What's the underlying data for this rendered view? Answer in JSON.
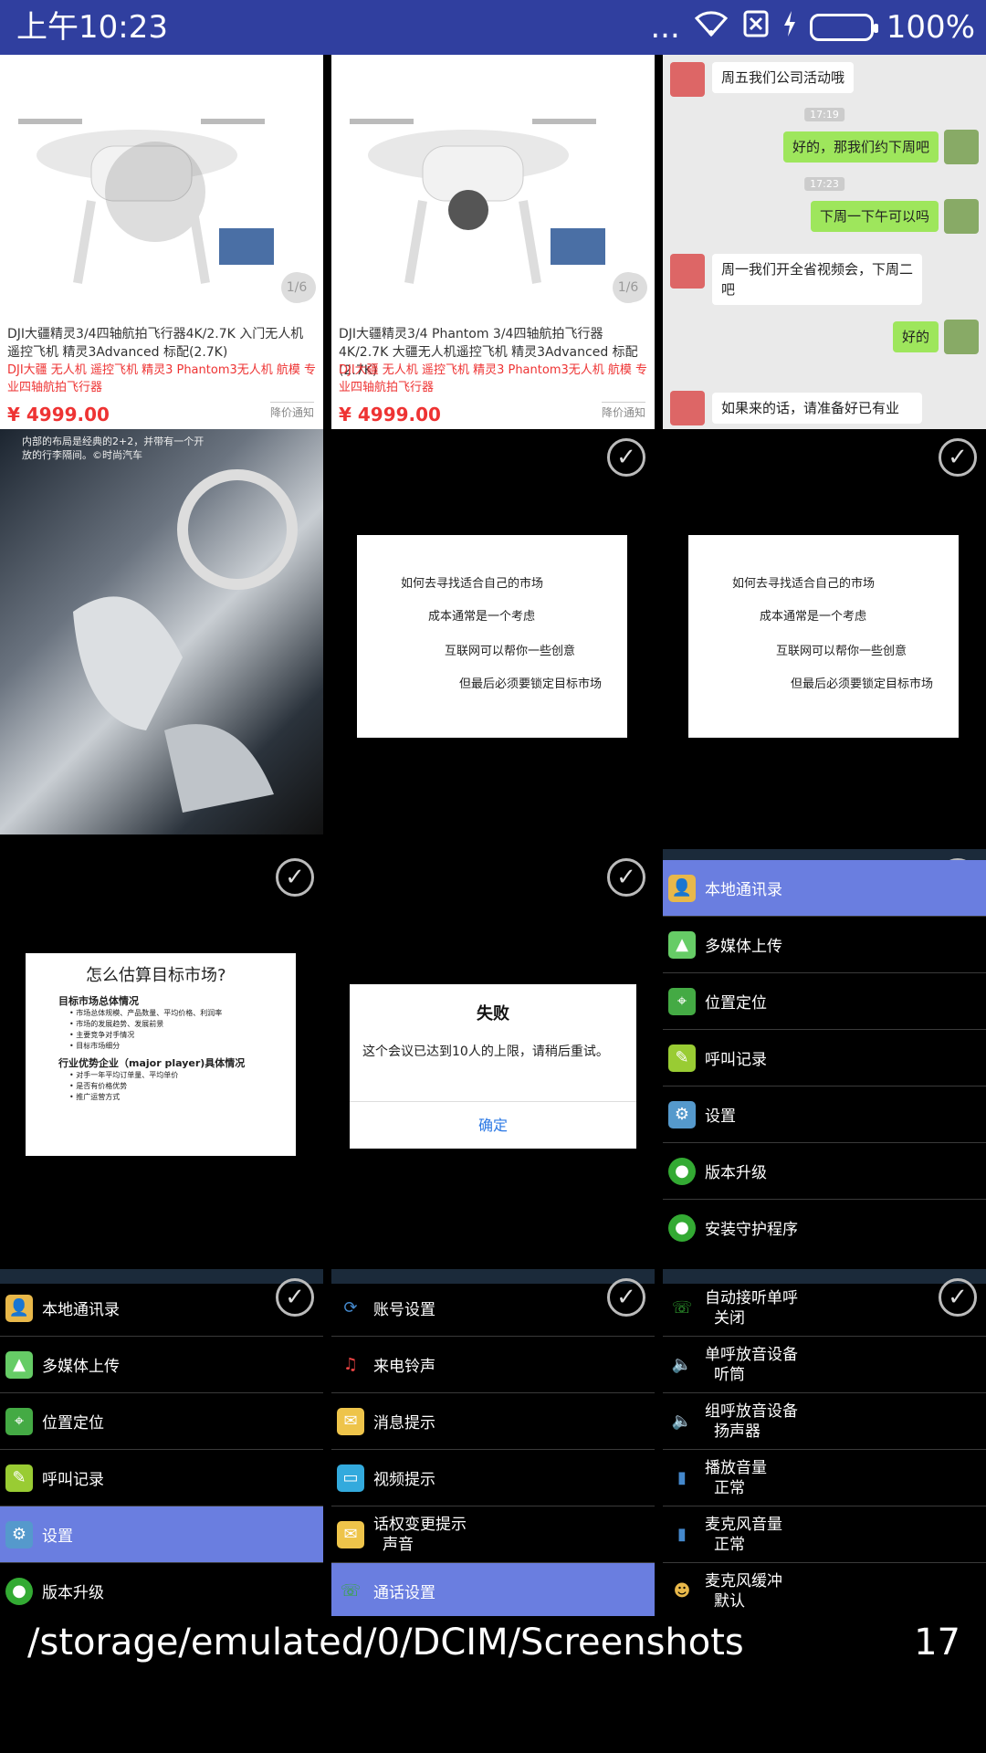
{
  "status_bar": {
    "time": "上午10:23",
    "dots": "...",
    "battery_percent": "100%"
  },
  "cells": {
    "p1": {
      "title": "DJI大疆精灵3/4四轴航拍飞行器4K/2.7K 入门无人机遥控飞机 精灵3Advanced 标配(2.7K)",
      "subtitle": "DJI大疆 无人机 遥控飞机 精灵3 Phantom3无人机 航模 专业四轴航拍飞行器",
      "price": "¥ 4999.00",
      "page": "1/6",
      "badge": "降价通知"
    },
    "p2": {
      "title": "DJI大疆精灵3/4 Phantom 3/4四轴航拍飞行器4K/2.7K 大疆无人机遥控飞机 精灵3Advanced 标配(2.7K)",
      "subtitle": "DJI大疆 无人机 遥控飞机 精灵3 Phantom3无人机 航模 专业四轴航拍飞行器",
      "price": "¥ 4999.00",
      "page": "1/6",
      "badge": "降价通知"
    },
    "chat": {
      "m1": "周五我们公司活动哦",
      "t1": "17:19",
      "m2": "好的，那我们约下周吧",
      "t2": "17:23",
      "m3": "下周一下午可以吗",
      "m4": "周一我们开全省视频会，下周二吧",
      "m5": "好的",
      "m6": "如果来的话，请准备好已有业"
    },
    "car": {
      "caption": "内部的布局是经典的2+2，并带有一个开放的行李隔间。©时尚汽车"
    },
    "slide1": {
      "l1": "如何去寻找适合自己的市场",
      "l2": "成本通常是一个考虑",
      "l3": "互联网可以帮你一些创意",
      "l4": "但最后必须要锁定目标市场"
    },
    "slide2": {
      "l1": "如何去寻找适合自己的市场",
      "l2": "成本通常是一个考虑",
      "l3": "互联网可以帮你一些创意",
      "l4": "但最后必须要锁定目标市场"
    },
    "slide3": {
      "title": "怎么估算目标市场?",
      "h1": "目标市场总体情况",
      "b1": "• 市场总体规模、产品数量、平均价格、利润率",
      "b2": "• 市场的发展趋势、发展前景",
      "b3": "• 主要竞争对手情况",
      "b4": "• 目标市场细分",
      "h2": "行业优势企业（major player)具体情况",
      "b5": "• 对手一年平均订单量、平均单价",
      "b6": "• 是否有价格优势",
      "b7": "• 推广运营方式"
    },
    "dialog": {
      "title": "失败",
      "body": "这个会议已达到10人的上限，请稍后重试。",
      "ok": "确定"
    },
    "menu1": [
      "本地通讯录",
      "多媒体上传",
      "位置定位",
      "呼叫记录",
      "设置",
      "版本升级",
      "安装守护程序"
    ],
    "menu2": [
      "本地通讯录",
      "多媒体上传",
      "位置定位",
      "呼叫记录",
      "设置",
      "版本升级"
    ],
    "menu3": {
      "i1": "账号设置",
      "i2": "来电铃声",
      "i3": "消息提示",
      "i4": "视频提示",
      "i5a": "话权变更提示",
      "i5b": "声音",
      "i6": "通话设置"
    },
    "menu4": {
      "a1": "自动接听单呼",
      "b1": "关闭",
      "a2": "单呼放音设备",
      "b2": "听筒",
      "a3": "组呼放音设备",
      "b3": "扬声器",
      "a4": "播放音量",
      "b4": "正常",
      "a5": "麦克风音量",
      "b5": "正常",
      "a6": "麦克风缓冲",
      "b6": "默认"
    }
  },
  "footer": {
    "path": "/storage/emulated/0/DCIM/Screenshots",
    "count": "17"
  },
  "colors": {
    "status_bar": "#303f9f",
    "selected_row": "#6a7ee0",
    "price_red": "#ee3333",
    "chat_green": "#9ee65c"
  }
}
